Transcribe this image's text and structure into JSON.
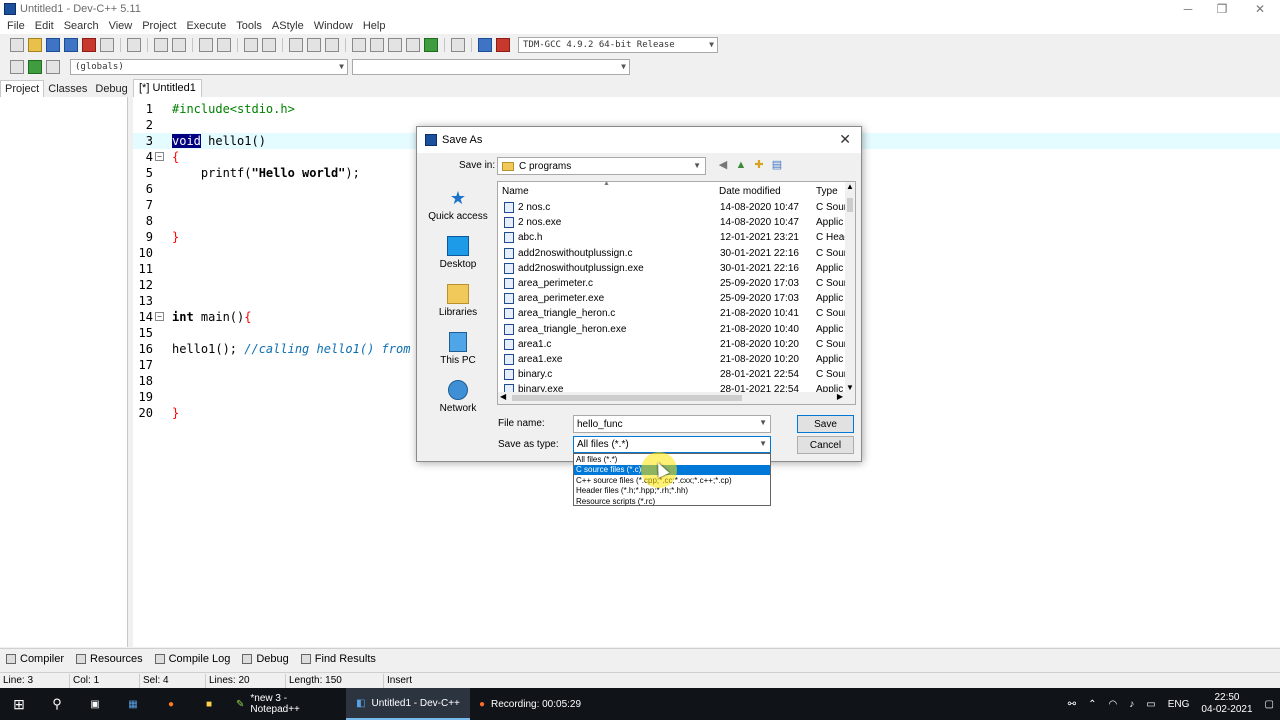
{
  "window": {
    "title": "Untitled1 - Dev-C++ 5.11",
    "minimize": "─",
    "maximize": "❐",
    "close": "✕"
  },
  "menu": [
    "File",
    "Edit",
    "Search",
    "View",
    "Project",
    "Execute",
    "Tools",
    "AStyle",
    "Window",
    "Help"
  ],
  "toolbar": {
    "compiler": "TDM-GCC 4.9.2 64-bit Release",
    "scope": "(globals)",
    "member": ""
  },
  "side_tabs": [
    "Project",
    "Classes",
    "Debug"
  ],
  "editor_tab": "[*] Untitled1",
  "code": [
    {
      "n": "1",
      "fold": "",
      "hl": false,
      "parts": [
        {
          "t": "#include<stdio.h>",
          "c": "pp"
        }
      ]
    },
    {
      "n": "2",
      "fold": "",
      "hl": false,
      "parts": []
    },
    {
      "n": "3",
      "fold": "",
      "hl": true,
      "parts": [
        {
          "t": "void",
          "c": "kwsel"
        },
        {
          "t": " hello1()",
          "c": ""
        }
      ]
    },
    {
      "n": "4",
      "fold": "−",
      "hl": false,
      "parts": [
        {
          "t": "{",
          "c": "br"
        }
      ]
    },
    {
      "n": "5",
      "fold": "",
      "hl": false,
      "parts": [
        {
          "t": "    printf(",
          "c": ""
        },
        {
          "t": "\"Hello world\"",
          "c": "kw"
        },
        {
          "t": ");",
          "c": ""
        }
      ]
    },
    {
      "n": "6",
      "fold": "",
      "hl": false,
      "parts": []
    },
    {
      "n": "7",
      "fold": "",
      "hl": false,
      "parts": []
    },
    {
      "n": "8",
      "fold": "",
      "hl": false,
      "parts": []
    },
    {
      "n": "9",
      "fold": "",
      "hl": false,
      "parts": [
        {
          "t": "}",
          "c": "br"
        }
      ]
    },
    {
      "n": "10",
      "fold": "",
      "hl": false,
      "parts": []
    },
    {
      "n": "11",
      "fold": "",
      "hl": false,
      "parts": []
    },
    {
      "n": "12",
      "fold": "",
      "hl": false,
      "parts": []
    },
    {
      "n": "13",
      "fold": "",
      "hl": false,
      "parts": []
    },
    {
      "n": "14",
      "fold": "−",
      "hl": false,
      "parts": [
        {
          "t": "int",
          "c": "kw"
        },
        {
          "t": " main()",
          "c": ""
        },
        {
          "t": "{",
          "c": "br"
        }
      ]
    },
    {
      "n": "15",
      "fold": "",
      "hl": false,
      "parts": []
    },
    {
      "n": "16",
      "fold": "",
      "hl": false,
      "parts": [
        {
          "t": "hello1(); ",
          "c": ""
        },
        {
          "t": "//calling hello1() from",
          "c": "cmt"
        }
      ]
    },
    {
      "n": "17",
      "fold": "",
      "hl": false,
      "parts": []
    },
    {
      "n": "18",
      "fold": "",
      "hl": false,
      "parts": []
    },
    {
      "n": "19",
      "fold": "",
      "hl": false,
      "parts": []
    },
    {
      "n": "20",
      "fold": "",
      "hl": false,
      "parts": [
        {
          "t": "}",
          "c": "br"
        }
      ]
    }
  ],
  "dialog": {
    "title": "Save As",
    "save_in_label": "Save in:",
    "save_in_value": "C programs",
    "places": [
      "Quick access",
      "Desktop",
      "Libraries",
      "This PC",
      "Network"
    ],
    "columns": {
      "name": "Name",
      "date": "Date modified",
      "type": "Type"
    },
    "files": [
      {
        "name": "2 nos.c",
        "date": "14-08-2020 10:47",
        "type": "C Sour"
      },
      {
        "name": "2 nos.exe",
        "date": "14-08-2020 10:47",
        "type": "Applic"
      },
      {
        "name": "abc.h",
        "date": "12-01-2021 23:21",
        "type": "C Head"
      },
      {
        "name": "add2noswithoutplussign.c",
        "date": "30-01-2021 22:16",
        "type": "C Sour"
      },
      {
        "name": "add2noswithoutplussign.exe",
        "date": "30-01-2021 22:16",
        "type": "Applic"
      },
      {
        "name": "area_perimeter.c",
        "date": "25-09-2020 17:03",
        "type": "C Sour"
      },
      {
        "name": "area_perimeter.exe",
        "date": "25-09-2020 17:03",
        "type": "Applic"
      },
      {
        "name": "area_triangle_heron.c",
        "date": "21-08-2020 10:41",
        "type": "C Sour"
      },
      {
        "name": "area_triangle_heron.exe",
        "date": "21-08-2020 10:40",
        "type": "Applic"
      },
      {
        "name": "area1.c",
        "date": "21-08-2020 10:20",
        "type": "C Sour"
      },
      {
        "name": "area1.exe",
        "date": "21-08-2020 10:20",
        "type": "Applic"
      },
      {
        "name": "binary.c",
        "date": "28-01-2021 22:54",
        "type": "C Sour"
      },
      {
        "name": "binary.exe",
        "date": "28-01-2021 22:54",
        "type": "Applic"
      }
    ],
    "file_name_label": "File name:",
    "file_name_value": "hello_func",
    "save_type_label": "Save as type:",
    "save_type_value": "All files (*.*)",
    "save_button": "Save",
    "cancel_button": "Cancel",
    "type_options": [
      {
        "label": "All files (*.*)",
        "selected": false
      },
      {
        "label": "C source files (*.c)",
        "selected": true
      },
      {
        "label": "C++ source files (*.cpp;*.cc;*.cxx;*.c++;*.cp)",
        "selected": false
      },
      {
        "label": "Header files (*.h;*.hpp;*.rh;*.hh)",
        "selected": false
      },
      {
        "label": "Resource scripts (*.rc)",
        "selected": false
      }
    ]
  },
  "bottom_tabs": [
    "Compiler",
    "Resources",
    "Compile Log",
    "Debug",
    "Find Results"
  ],
  "status": {
    "line_label": "Line:",
    "line": "3",
    "col_label": "Col:",
    "col": "1",
    "sel_label": "Sel:",
    "sel": "4",
    "lines_label": "Lines:",
    "lines": "20",
    "length_label": "Length:",
    "length": "150",
    "mode": "Insert"
  },
  "taskbar": {
    "notepad": "*new 3 - Notepad++",
    "devcpp": "Untitled1 - Dev-C++",
    "recording": "Recording: 00:05:29",
    "lang": "ENG",
    "time": "22:50",
    "date": "04-02-2021"
  }
}
